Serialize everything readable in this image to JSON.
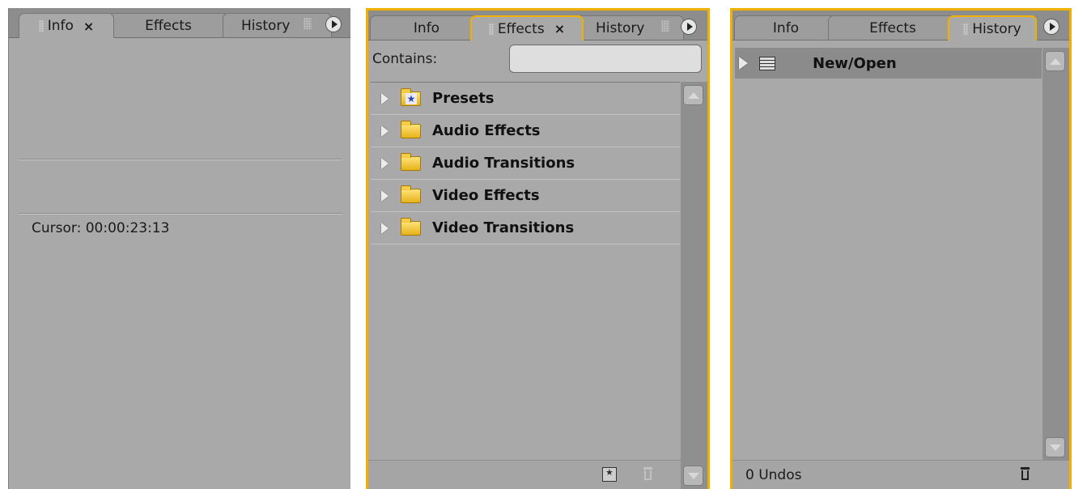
{
  "panels": {
    "info": {
      "tabs": [
        "Info",
        "Effects",
        "History"
      ],
      "close_glyph": "×",
      "cursor_label": "Cursor:",
      "cursor_value": "00:00:23:13"
    },
    "effects": {
      "tabs": [
        "Info",
        "Effects",
        "History"
      ],
      "close_glyph": "×",
      "search_label": "Contains:",
      "search_value": "",
      "search_placeholder": "",
      "folders": [
        {
          "label": "Presets",
          "icon": "preset-folder-icon"
        },
        {
          "label": "Audio Effects",
          "icon": "folder-icon"
        },
        {
          "label": "Audio Transitions",
          "icon": "folder-icon"
        },
        {
          "label": "Video Effects",
          "icon": "folder-icon"
        },
        {
          "label": "Video Transitions",
          "icon": "folder-icon"
        }
      ]
    },
    "history": {
      "tabs": [
        "Info",
        "Effects",
        "History"
      ],
      "entries": [
        {
          "label": "New/Open",
          "icon": "list-icon"
        }
      ],
      "undos_label": "0 Undos"
    }
  },
  "colors": {
    "panel_bg": "#a9a9a9",
    "tabbar_bg": "#8d8d8d",
    "active_outline": "#f0b000",
    "selected_row": "#8b8b8b"
  }
}
